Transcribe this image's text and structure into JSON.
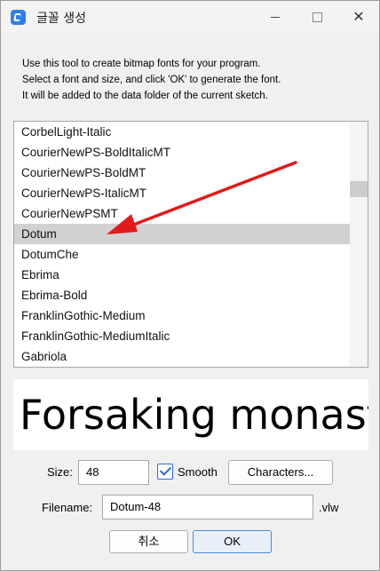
{
  "window": {
    "title": "글꼴 생성",
    "icon": "app-icon"
  },
  "intro": {
    "lines": [
      "Use this tool to create bitmap fonts for your program.",
      "Select a font and size, and click 'OK' to generate the font.",
      "It will be added to the data folder of the current sketch."
    ]
  },
  "font_list": {
    "items": [
      "CorbelLight-Italic",
      "CourierNewPS-BoldItalicMT",
      "CourierNewPS-BoldMT",
      "CourierNewPS-ItalicMT",
      "CourierNewPSMT",
      "Dotum",
      "DotumChe",
      "Ebrima",
      "Ebrima-Bold",
      "FranklinGothic-Medium",
      "FranklinGothic-MediumItalic",
      "Gabriola"
    ],
    "selected": "Dotum",
    "annotation_arrow_color": "#e11b1b"
  },
  "preview": {
    "text": "Forsaking monast"
  },
  "size": {
    "label": "Size:",
    "value": "48"
  },
  "smooth": {
    "label": "Smooth",
    "checked": true
  },
  "characters_button": "Characters...",
  "filename": {
    "label": "Filename:",
    "value": "Dotum-48",
    "extension": ".vlw"
  },
  "buttons": {
    "cancel": "취소",
    "ok": "OK"
  },
  "colors": {
    "accent": "#2a6ed8",
    "selection": "#d1d1d1"
  }
}
